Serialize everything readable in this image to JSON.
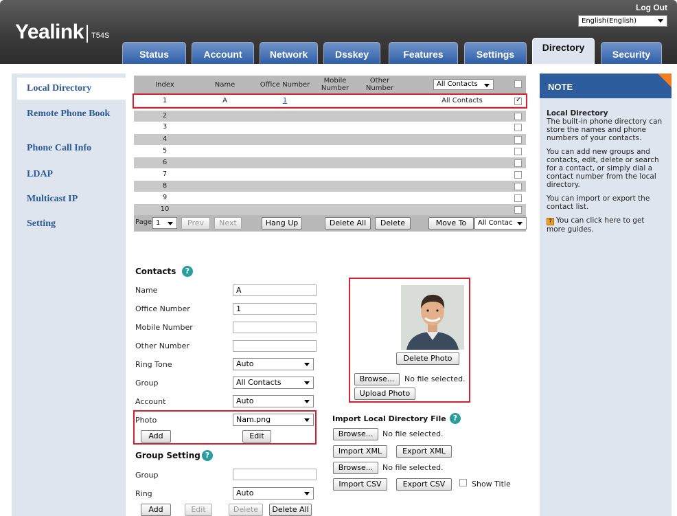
{
  "header": {
    "logo": "Yealink",
    "model": "T54S",
    "logout": "Log Out",
    "language": "English(English)"
  },
  "tabs": [
    "Status",
    "Account",
    "Network",
    "Dsskey",
    "Features",
    "Settings",
    "Directory",
    "Security"
  ],
  "active_tab": "Directory",
  "sidebar": {
    "items": [
      "Local Directory",
      "Remote Phone Book",
      "Phone Call Info",
      "LDAP",
      "Multicast IP",
      "Setting"
    ]
  },
  "table": {
    "headers": [
      "Index",
      "Name",
      "Office Number",
      "Mobile Number",
      "Other Number"
    ],
    "group_filter": "All Contacts",
    "rows": [
      {
        "index": "1",
        "name": "A",
        "office": "1",
        "group": "All Contacts",
        "checked": true
      },
      {
        "index": "2"
      },
      {
        "index": "3"
      },
      {
        "index": "4"
      },
      {
        "index": "5"
      },
      {
        "index": "6"
      },
      {
        "index": "7"
      },
      {
        "index": "8"
      },
      {
        "index": "9"
      },
      {
        "index": "10"
      }
    ]
  },
  "pager": {
    "page_label": "Page",
    "page": "1",
    "prev": "Prev",
    "next": "Next",
    "hang_up": "Hang Up",
    "delete_all": "Delete All",
    "delete": "Delete",
    "move_to": "Move To",
    "move_target": "All Contac"
  },
  "contacts": {
    "title": "Contacts",
    "fields": {
      "name_label": "Name",
      "name_value": "A",
      "office_label": "Office Number",
      "office_value": "1",
      "mobile_label": "Mobile Number",
      "mobile_value": "",
      "other_label": "Other Number",
      "other_value": "",
      "ring_label": "Ring Tone",
      "ring_value": "Auto",
      "group_label": "Group",
      "group_value": "All Contacts",
      "account_label": "Account",
      "account_value": "Auto",
      "photo_label": "Photo",
      "photo_value": "Nam.png"
    },
    "add": "Add",
    "edit": "Edit"
  },
  "photo_panel": {
    "delete_photo": "Delete Photo",
    "browse": "Browse...",
    "no_file": "No file selected.",
    "upload_photo": "Upload Photo"
  },
  "import": {
    "title": "Import Local Directory File",
    "browse": "Browse...",
    "no_file": "No file selected.",
    "import_xml": "Import XML",
    "export_xml": "Export XML",
    "import_csv": "Import CSV",
    "export_csv": "Export CSV",
    "show_title": "Show Title"
  },
  "group_setting": {
    "title": "Group Setting",
    "group_label": "Group",
    "group_value": "",
    "ring_label": "Ring",
    "ring_value": "Auto",
    "add": "Add",
    "edit": "Edit",
    "delete": "Delete",
    "delete_all": "Delete All"
  },
  "note": {
    "title": "NOTE",
    "heading": "Local Directory",
    "p1": "The built-in phone directory can store the names and phone numbers of your contacts.",
    "p2": "You can add new groups and contacts, edit, delete or search for a contact, or simply dial a contact number from the local directory.",
    "p3": "You can import or export the contact list.",
    "p4": "You can click here to get more guides."
  },
  "colors": {
    "nav_blue": "#2e5d9e",
    "accent_orange": "#f47d20",
    "highlight_red": "#d62030"
  }
}
